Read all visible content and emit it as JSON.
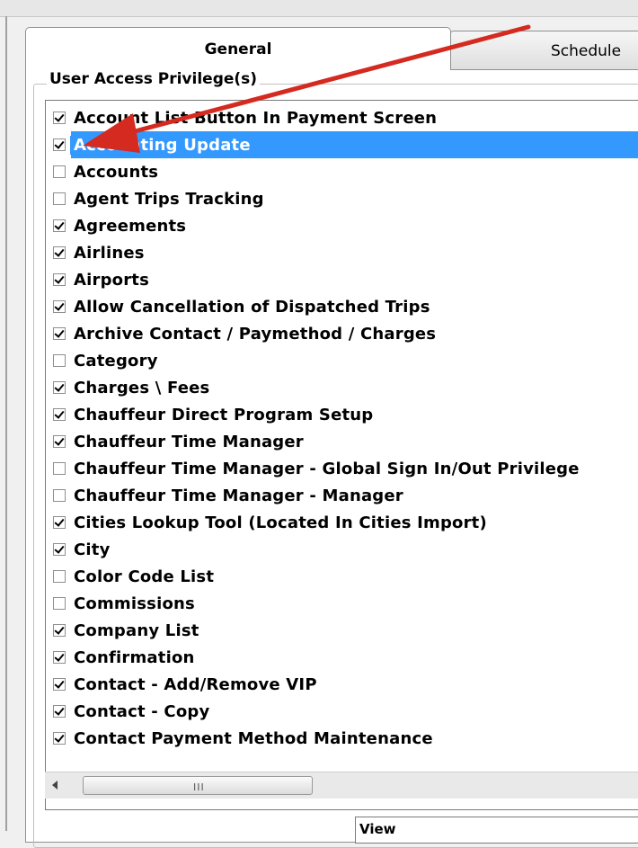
{
  "tabs": {
    "general": "General",
    "schedule": "Schedule"
  },
  "group": {
    "label": "User Access Privilege(s)"
  },
  "items": [
    {
      "label": "Account List Button In Payment Screen",
      "checked": true,
      "selected": false
    },
    {
      "label": "Accounting Update",
      "checked": true,
      "selected": true
    },
    {
      "label": "Accounts",
      "checked": false,
      "selected": false
    },
    {
      "label": "Agent Trips Tracking",
      "checked": false,
      "selected": false
    },
    {
      "label": "Agreements",
      "checked": true,
      "selected": false
    },
    {
      "label": "Airlines",
      "checked": true,
      "selected": false
    },
    {
      "label": "Airports",
      "checked": true,
      "selected": false
    },
    {
      "label": "Allow Cancellation of Dispatched Trips",
      "checked": true,
      "selected": false
    },
    {
      "label": "Archive Contact / Paymethod / Charges",
      "checked": true,
      "selected": false
    },
    {
      "label": "Category",
      "checked": false,
      "selected": false
    },
    {
      "label": "Charges \\ Fees",
      "checked": true,
      "selected": false
    },
    {
      "label": "Chauffeur Direct Program Setup",
      "checked": true,
      "selected": false
    },
    {
      "label": "Chauffeur Time Manager",
      "checked": true,
      "selected": false
    },
    {
      "label": "Chauffeur Time Manager - Global Sign In/Out Privilege",
      "checked": false,
      "selected": false
    },
    {
      "label": "Chauffeur Time Manager - Manager",
      "checked": false,
      "selected": false
    },
    {
      "label": "Cities Lookup Tool (Located In Cities Import)",
      "checked": true,
      "selected": false
    },
    {
      "label": "City",
      "checked": true,
      "selected": false
    },
    {
      "label": "Color Code List",
      "checked": false,
      "selected": false
    },
    {
      "label": "Commissions",
      "checked": false,
      "selected": false
    },
    {
      "label": "Company List",
      "checked": true,
      "selected": false
    },
    {
      "label": "Confirmation",
      "checked": true,
      "selected": false
    },
    {
      "label": "Contact - Add/Remove VIP",
      "checked": true,
      "selected": false
    },
    {
      "label": "Contact - Copy",
      "checked": true,
      "selected": false
    },
    {
      "label": "Contact Payment Method Maintenance",
      "checked": true,
      "selected": false
    }
  ],
  "scrollbar": {
    "grip": "III"
  },
  "bottom": {
    "view_label": "View"
  },
  "colors": {
    "selection": "#3399ff",
    "annotation_arrow": "#d42a20"
  },
  "icons": [
    "scroll-left-arrow-icon",
    "checkbox-check-icon",
    "annotation-arrow-icon"
  ]
}
